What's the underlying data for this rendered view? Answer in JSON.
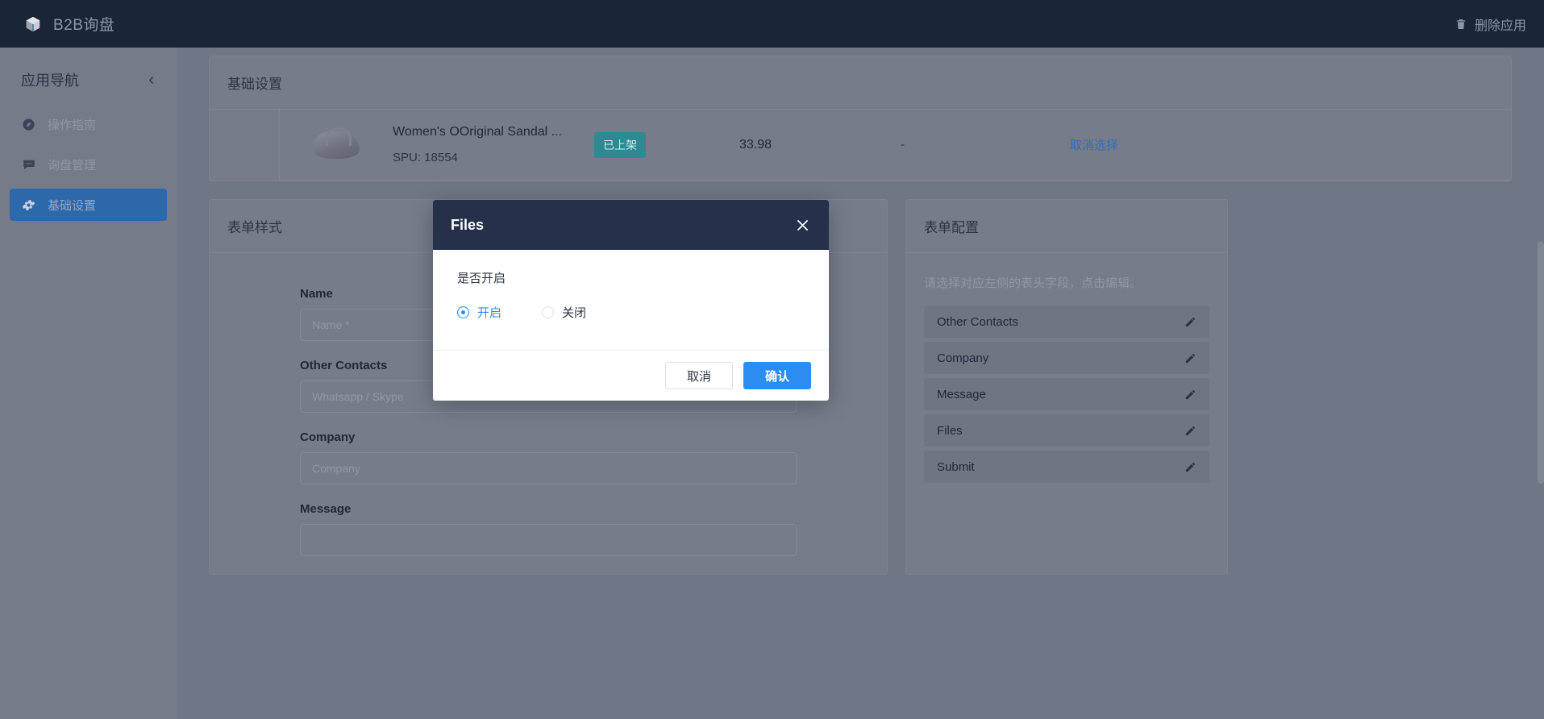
{
  "topbar": {
    "brand_icon": "cube-icon",
    "brand_title": "B2B询盘",
    "delete_icon": "trash-icon",
    "delete_label": "删除应用"
  },
  "sidebar": {
    "title": "应用导航",
    "collapse_icon": "chevron-left-icon",
    "items": [
      {
        "label": "操作指南",
        "icon": "compass-icon",
        "active": false
      },
      {
        "label": "询盘管理",
        "icon": "chat-icon",
        "active": false
      },
      {
        "label": "基础设置",
        "icon": "gear-icon",
        "active": true
      }
    ]
  },
  "settings_card": {
    "title": "基础设置",
    "product": {
      "thumb_icon": "sandal-image",
      "name": "Women's OOriginal Sandal ...",
      "spu": "SPU: 18554",
      "status_badge": "已上架",
      "price": "33.98",
      "extra": "-",
      "action_label": "取消选择"
    }
  },
  "form_card": {
    "title": "表单样式",
    "fields": [
      {
        "label": "Name",
        "placeholder": "Name *"
      },
      {
        "label": "Other Contacts",
        "placeholder": "Whatsapp / Skype"
      },
      {
        "label": "Company",
        "placeholder": "Company"
      },
      {
        "label": "Message",
        "placeholder": ""
      }
    ]
  },
  "config_card": {
    "title": "表单配置",
    "hint": "请选择对应左侧的表头字段，点击编辑。",
    "items": [
      {
        "label": "Other Contacts",
        "edit_icon": "pencil-icon"
      },
      {
        "label": "Company",
        "edit_icon": "pencil-icon"
      },
      {
        "label": "Message",
        "edit_icon": "pencil-icon"
      },
      {
        "label": "Files",
        "edit_icon": "pencil-icon"
      },
      {
        "label": "Submit",
        "edit_icon": "pencil-icon"
      }
    ]
  },
  "modal": {
    "title": "Files",
    "close_icon": "close-icon",
    "field_label": "是否开启",
    "options": [
      {
        "label": "开启",
        "selected": true
      },
      {
        "label": "关闭",
        "selected": false
      }
    ],
    "cancel_label": "取消",
    "confirm_label": "确认"
  },
  "colors": {
    "topbar_bg": "#1b2538",
    "accent_blue": "#2d8cf0",
    "nav_active": "#2d68ab",
    "badge_teal": "#2d8a92",
    "modal_header": "#25304b"
  }
}
